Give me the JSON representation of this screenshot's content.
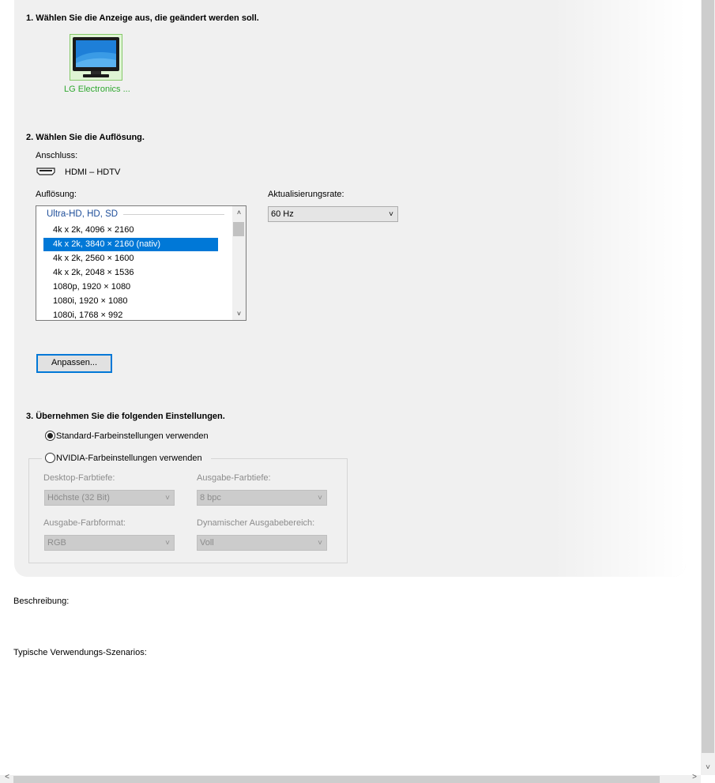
{
  "section1": {
    "heading": "1. Wählen Sie die Anzeige aus, die geändert werden soll.",
    "monitor_label": "LG Electronics ..."
  },
  "section2": {
    "heading": "2. Wählen Sie die Auflösung.",
    "connection_label": "Anschluss:",
    "connection_value": "HDMI – HDTV",
    "resolution_label": "Auflösung:",
    "refresh_label": "Aktualisierungsrate:",
    "refresh_value": "60 Hz",
    "group_header": "Ultra-HD, HD, SD",
    "resolutions": [
      "4k x 2k, 4096 × 2160",
      "4k x 2k, 3840 × 2160 (nativ)",
      "4k x 2k, 2560 × 1600",
      "4k x 2k, 2048 × 1536",
      "1080p, 1920 × 1080",
      "1080i, 1920 × 1080",
      "1080i, 1768 × 992"
    ],
    "selected_index": 1,
    "customize_button": "Anpassen..."
  },
  "section3": {
    "heading": "3. Übernehmen Sie die folgenden Einstellungen.",
    "radio_default": "Standard-Farbeinstellungen verwenden",
    "radio_nvidia": "NVIDIA-Farbeinstellungen verwenden",
    "desktop_depth_label": "Desktop-Farbtiefe:",
    "desktop_depth_value": "Höchste (32 Bit)",
    "output_depth_label": "Ausgabe-Farbtiefe:",
    "output_depth_value": "8 bpc",
    "output_format_label": "Ausgabe-Farbformat:",
    "output_format_value": "RGB",
    "dynamic_range_label": "Dynamischer Ausgabebereich:",
    "dynamic_range_value": "Voll"
  },
  "footer": {
    "description_label": "Beschreibung:",
    "scenarios_label": "Typische Verwendungs-Szenarios:"
  },
  "icons": {
    "monitor": "monitor-icon",
    "hdmi": "hdmi-connector-icon",
    "dropdown": "chevron-down-icon"
  },
  "colors": {
    "selection": "#0078d7",
    "monitor_caption": "#2fa82f",
    "group_header": "#1e4e9a"
  }
}
